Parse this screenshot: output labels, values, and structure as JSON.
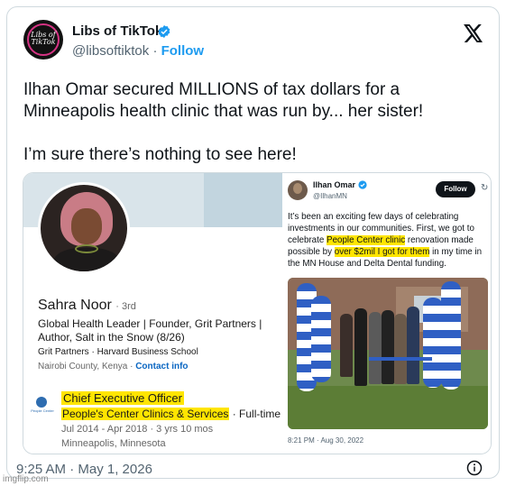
{
  "tweet": {
    "author_name": "Libs of TikTok",
    "handle": "@libsoftiktok",
    "separator": "·",
    "follow_label": "Follow",
    "avatar_text": "Libs of TikTok",
    "lines": [
      "Ilhan Omar secured MILLIONS of tax dollars for a",
      "Minneapolis health clinic that was run by... her sister!",
      "I’m sure there’s nothing to see here!"
    ],
    "timestamp": "9:25 AM · May 1, 2026",
    "accent_color": "#1d9bf0"
  },
  "linkedin": {
    "name": "Sahra Noor",
    "degree": "· 3rd",
    "headline": "Global Health Leader | Founder, Grit Partners | Author, Salt in the Snow (8/26)",
    "companies": "Grit Partners · Harvard Business School",
    "location": "Nairobi County, Kenya",
    "location_sep": " · ",
    "contact_link": "Contact info",
    "company_logo_text": "People Center",
    "job_title": "Chief Executive Officer",
    "org_name": "People's Center Clinics & Services",
    "employment_type": " · Full-time",
    "dates": "Jul 2014 - Apr 2018 · 3 yrs 10 mos",
    "city": "Minneapolis, Minnesota",
    "highlight_color": "#ffe500"
  },
  "embedded_tweet": {
    "name": "Ilhan Omar",
    "handle": "@IlhanMN",
    "follow_label": "Follow",
    "text_part1": "It’s been an exciting few days of celebrating investments in our communities. First, we got to celebrate ",
    "text_hl1": "People Center clinic",
    "text_part2": " renovation made possible by ",
    "text_hl2": "over $2mil I got for them",
    "text_part3": " in my time in the MN House and Delta Dental funding.",
    "timestamp": "8:21 PM · Aug 30, 2022"
  },
  "watermark": "imgflip.com",
  "icons": {
    "close": "x-logo-icon",
    "verified": "verified-badge-icon",
    "info": "info-icon",
    "refresh": "refresh-icon"
  }
}
